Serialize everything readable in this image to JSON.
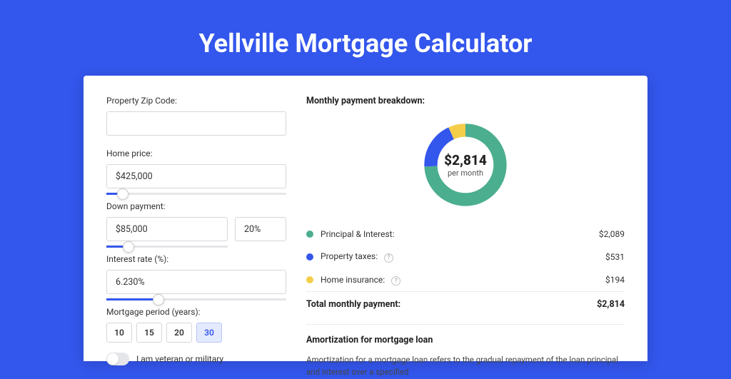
{
  "hero": {
    "title": "Yellville Mortgage Calculator"
  },
  "form": {
    "zip_label": "Property Zip Code:",
    "zip_value": "",
    "home_price_label": "Home price:",
    "home_price_value": "$425,000",
    "home_price_pct": 9,
    "down_label": "Down payment:",
    "down_value": "$85,000",
    "down_pct_value": "20%",
    "down_slider_pct": 18,
    "rate_label": "Interest rate (%):",
    "rate_value": "6.230%",
    "rate_slider_pct": 29,
    "period_label": "Mortgage period (years):",
    "periods": [
      "10",
      "15",
      "20",
      "30"
    ],
    "period_active": "30",
    "veteran_label": "I am veteran or military"
  },
  "breakdown": {
    "title": "Monthly payment breakdown:",
    "center_amount": "$2,814",
    "center_sub": "per month",
    "items": [
      {
        "label": "Principal & Interest:",
        "value": "$2,089",
        "color": "#4bae8f",
        "pct": 74.2,
        "help": false
      },
      {
        "label": "Property taxes:",
        "value": "$531",
        "color": "#3356ec",
        "pct": 18.9,
        "help": true
      },
      {
        "label": "Home insurance:",
        "value": "$194",
        "color": "#f4cd49",
        "pct": 6.9,
        "help": true
      }
    ],
    "total_label": "Total monthly payment:",
    "total_value": "$2,814"
  },
  "amort": {
    "title": "Amortization for mortgage loan",
    "text": "Amortization for a mortgage loan refers to the gradual repayment of the loan principal and interest over a specified"
  },
  "chart_data": {
    "type": "pie",
    "title": "Monthly payment breakdown",
    "categories": [
      "Principal & Interest",
      "Property taxes",
      "Home insurance"
    ],
    "values": [
      2089,
      531,
      194
    ],
    "colors": [
      "#4bae8f",
      "#3356ec",
      "#f4cd49"
    ],
    "total": 2814,
    "unit": "USD per month"
  }
}
